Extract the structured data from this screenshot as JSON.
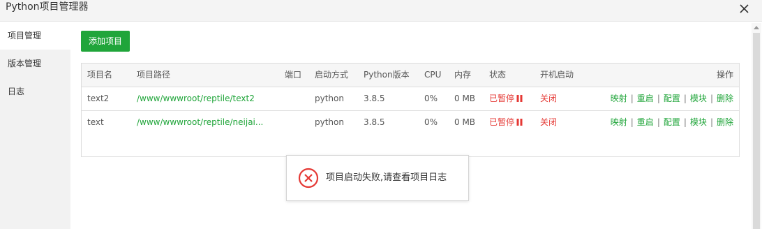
{
  "window": {
    "title": "Python项目管理器"
  },
  "sidebar": {
    "items": [
      {
        "label": "项目管理",
        "active": true
      },
      {
        "label": "版本管理",
        "active": false
      },
      {
        "label": "日志",
        "active": false
      }
    ]
  },
  "toolbar": {
    "add_label": "添加项目"
  },
  "table": {
    "headers": {
      "name": "项目名",
      "path": "项目路径",
      "port": "端口",
      "start_mode": "启动方式",
      "python_version": "Python版本",
      "cpu": "CPU",
      "memory": "内存",
      "status": "状态",
      "boot": "开机启动",
      "actions": "操作"
    },
    "rows": [
      {
        "name": "text2",
        "path": "/www/wwwroot/reptile/text2",
        "port": "",
        "start_mode": "python",
        "python_version": "3.8.5",
        "cpu": "0%",
        "memory": "0 MB",
        "status": "已暂停",
        "boot": "关闭",
        "actions": [
          "映射",
          "重启",
          "配置",
          "模块",
          "删除"
        ]
      },
      {
        "name": "text",
        "path": "/www/wwwroot/reptile/neijai...",
        "port": "",
        "start_mode": "python",
        "python_version": "3.8.5",
        "cpu": "0%",
        "memory": "0 MB",
        "status": "已暂停",
        "boot": "关闭",
        "actions": [
          "映射",
          "重启",
          "配置",
          "模块",
          "删除"
        ]
      }
    ]
  },
  "toast": {
    "message": "项目启动失败,请查看项目日志"
  },
  "colors": {
    "accent": "#20a53a",
    "danger": "#e53935"
  },
  "icons": {
    "close": "close-icon",
    "pause": "pause-icon",
    "error": "error-circle-icon",
    "scroll_up": "arrow-up-icon"
  }
}
